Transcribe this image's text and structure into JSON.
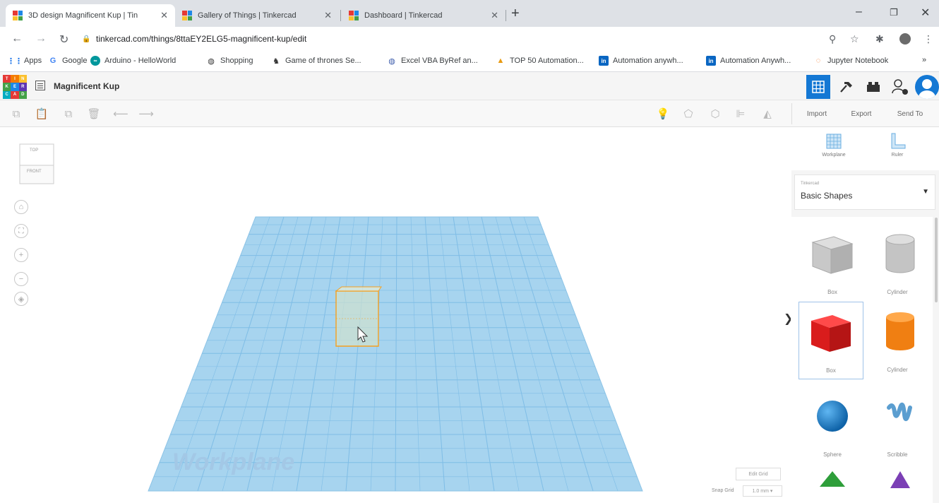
{
  "browser": {
    "tabs": [
      {
        "title": "3D design Magnificent Kup | Tin",
        "active": true
      },
      {
        "title": "Gallery of Things | Tinkercad",
        "active": false
      },
      {
        "title": "Dashboard | Tinkercad",
        "active": false
      }
    ],
    "url": "tinkercad.com/things/8ttaEY2ELG5-magnificent-kup/edit",
    "bookmarks": [
      {
        "label": "Apps",
        "icon": "apps-grid-icon"
      },
      {
        "label": "Google",
        "icon": "google-icon"
      },
      {
        "label": "Arduino - HelloWorld",
        "icon": "arduino-icon"
      },
      {
        "label": "Shopping",
        "icon": "globe-icon"
      },
      {
        "label": "Game of thrones Se...",
        "icon": "figure-icon"
      },
      {
        "label": "Excel VBA ByRef an...",
        "icon": "globe-icon"
      },
      {
        "label": "TOP 50 Automation...",
        "icon": "cone-icon"
      },
      {
        "label": "Automation anywh...",
        "icon": "linkedin-icon"
      },
      {
        "label": "Automation Anywh...",
        "icon": "linkedin-icon"
      },
      {
        "label": "Jupyter Notebook",
        "icon": "jupyter-icon"
      }
    ],
    "more_bookmarks": "»"
  },
  "app": {
    "design_title": "Magnificent Kup",
    "logo_letters": [
      "TIN",
      "KER",
      "CAD"
    ]
  },
  "toolbar": {
    "import_label": "Import",
    "export_label": "Export",
    "sendto_label": "Send To"
  },
  "canvas": {
    "viewcube_top": "TOP",
    "viewcube_front": "FRONT",
    "workplane_label": "Workplane",
    "edit_grid_label": "Edit Grid",
    "snap_grid_label": "Snap Grid",
    "snap_grid_value": "1.0 mm ▾",
    "collapse_glyph": "❯"
  },
  "panel": {
    "workplane_label": "Workplane",
    "ruler_label": "Ruler",
    "library_category": "Tinkercad",
    "library_name": "Basic Shapes",
    "shapes": [
      {
        "label": "Box",
        "color": "#b8b8b8"
      },
      {
        "label": "Cylinder",
        "color": "#b8b8b8"
      },
      {
        "label": "Box",
        "color": "#e01e1e"
      },
      {
        "label": "Cylinder",
        "color": "#f07f12"
      },
      {
        "label": "Sphere",
        "color": "#1479c9"
      },
      {
        "label": "Scribble",
        "color": "#5b9ed0"
      }
    ]
  },
  "colors": {
    "accent": "#1478d4",
    "workplane": "#a7d4ef",
    "selection": "#f5a020"
  }
}
